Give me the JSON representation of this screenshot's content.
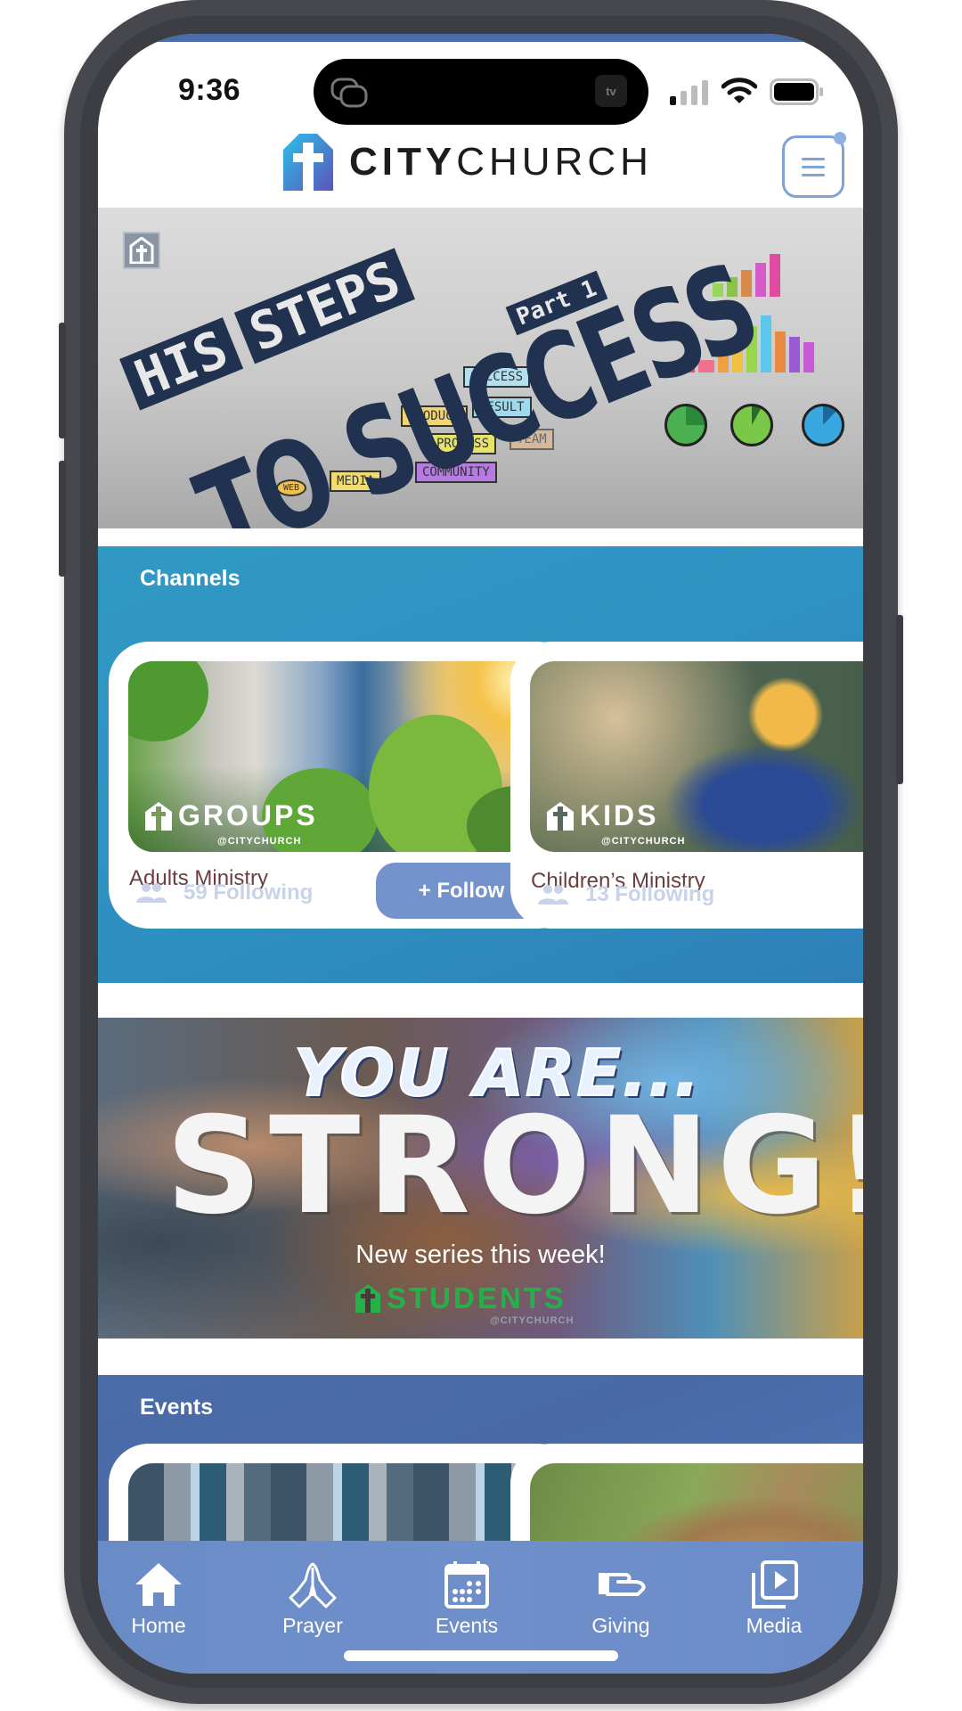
{
  "status_bar": {
    "time": "9:36",
    "island_app": "tv",
    "icons": [
      "screen-mirroring-icon",
      "apple-tv-icon",
      "signal-icon",
      "wifi-icon",
      "battery-icon"
    ]
  },
  "header": {
    "logo_bold": "CITY",
    "logo_regular": "CHURCH",
    "menu_icon": "hamburger-menu-icon"
  },
  "hero": {
    "line1_words": [
      "HIS",
      "STEPS"
    ],
    "line2": "TO SUCCESS",
    "part": "Part 1",
    "doodles": [
      "SUCCESS",
      "RESULT",
      "PRODUCT",
      "PROCESS",
      "TEAM",
      "COMMUNITY",
      "MEDIA",
      "WEB"
    ]
  },
  "channels": {
    "title": "Channels",
    "items": [
      {
        "tag": "GROUPS",
        "tag_sub": "@CITYCHURCH",
        "name": "Adults Ministry",
        "following": "59 Following",
        "follow_label": "+ Follow"
      },
      {
        "tag": "KIDS",
        "tag_sub": "@CITYCHURCH",
        "name": "Children’s Ministry",
        "following": "13 Following"
      }
    ]
  },
  "promo": {
    "line1": "YOU ARE...",
    "line2": "STRONG!",
    "subtitle": "New series this week!",
    "brand": "STUDENTS",
    "brand_sub": "@CITYCHURCH"
  },
  "events": {
    "title": "Events"
  },
  "bottom_nav": {
    "items": [
      {
        "label": "Home",
        "icon": "home-icon"
      },
      {
        "label": "Prayer",
        "icon": "praying-hands-icon"
      },
      {
        "label": "Events",
        "icon": "calendar-icon"
      },
      {
        "label": "Giving",
        "icon": "giving-hand-icon"
      },
      {
        "label": "Media",
        "icon": "media-play-icon"
      }
    ]
  },
  "colors": {
    "channels_bg": "#2e96c4",
    "events_bg": "#4a6ca8",
    "nav_bg": "#6f8fca",
    "follow_btn": "#7493cc",
    "card_name": "#6b3e3e",
    "students_green": "#26b04a"
  }
}
